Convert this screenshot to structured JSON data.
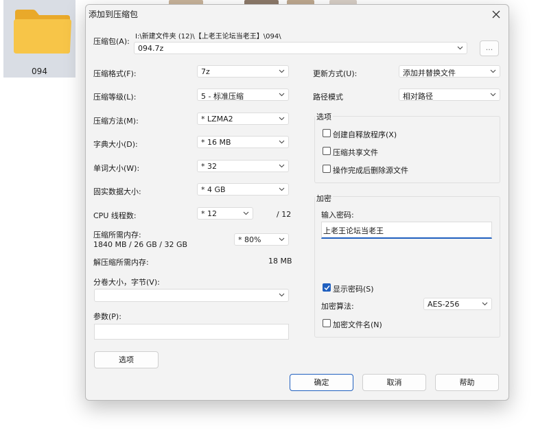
{
  "desktop": {
    "folder_name": "094",
    "colors": {
      "folder": "#f7c548",
      "tile": "#d9dde4"
    }
  },
  "dialog": {
    "title": "添加到压缩包",
    "archive": {
      "label": "压缩包(A):",
      "path": "I:\\新建文件夹 (12)\\【上老王论坛当老王】\\094\\",
      "name": "094.7z",
      "browse_label": "..."
    },
    "left": {
      "format": {
        "label": "压缩格式(F):",
        "value": "7z"
      },
      "level": {
        "label": "压缩等级(L):",
        "value": "5 - 标准压缩"
      },
      "method": {
        "label": "压缩方法(M):",
        "value": "* LZMA2"
      },
      "dict": {
        "label": "字典大小(D):",
        "value": "* 16 MB"
      },
      "word": {
        "label": "单词大小(W):",
        "value": "* 32"
      },
      "solid": {
        "label": "固实数据大小:",
        "value": "* 4 GB"
      },
      "threads": {
        "label": "CPU 线程数:",
        "value": "* 12",
        "total": "/ 12"
      },
      "mem_compress": {
        "label": "压缩所需内存:",
        "detail": "1840 MB / 26 GB / 32 GB",
        "value": "* 80%"
      },
      "mem_decompress": {
        "label": "解压缩所需内存:",
        "value": "18 MB"
      },
      "volume": {
        "label": "分卷大小，字节(V):",
        "value": ""
      },
      "params": {
        "label": "参数(P):",
        "value": ""
      },
      "options_button": "选项"
    },
    "right": {
      "update": {
        "label": "更新方式(U):",
        "value": "添加并替换文件"
      },
      "path_mode": {
        "label": "路径模式",
        "value": "相对路径"
      },
      "options_group": {
        "title": "选项",
        "items": [
          {
            "label": "创建自释放程序(X)",
            "checked": false
          },
          {
            "label": "压缩共享文件",
            "checked": false
          },
          {
            "label": "操作完成后删除源文件",
            "checked": false
          }
        ]
      },
      "encryption": {
        "title": "加密",
        "password_label": "输入密码:",
        "password_value": "上老王论坛当老王",
        "show_password": {
          "label": "显示密码(S)",
          "checked": true
        },
        "method_label": "加密算法:",
        "method_value": "AES-256",
        "encrypt_names": {
          "label": "加密文件名(N)",
          "checked": false
        }
      }
    },
    "buttons": {
      "ok": "确定",
      "cancel": "取消",
      "help": "帮助"
    },
    "colors": {
      "accent": "#1f5fbf",
      "background": "#f3f3f3"
    }
  }
}
